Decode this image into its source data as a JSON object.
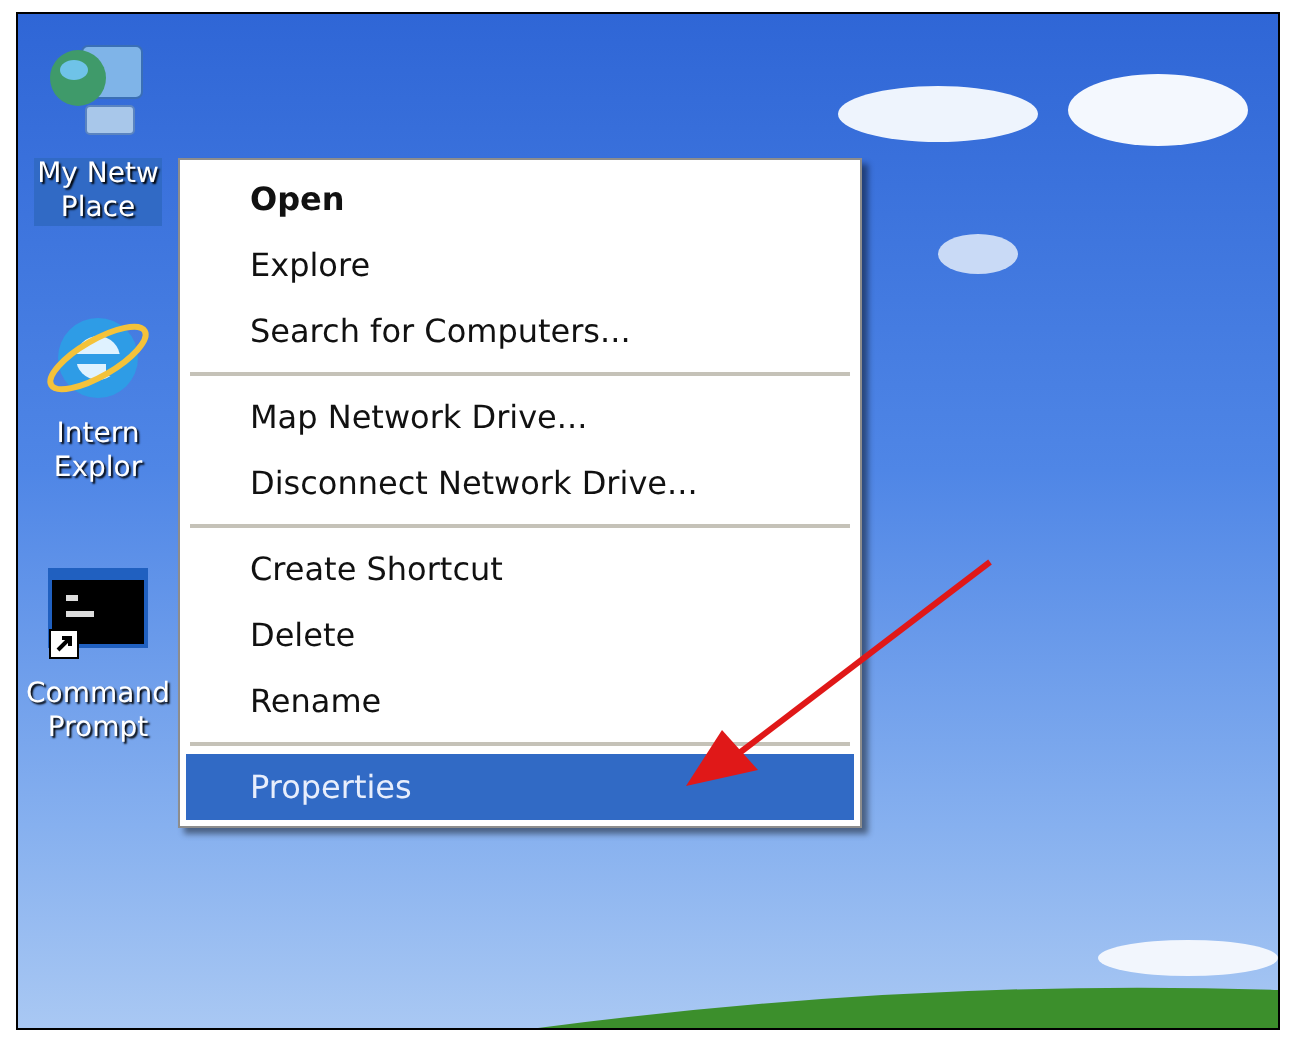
{
  "desktop_icons": [
    {
      "kind": "network",
      "label_lines": [
        "My Netw",
        "Place"
      ],
      "selected": true
    },
    {
      "kind": "browser",
      "label_lines": [
        "Intern",
        "Explor"
      ],
      "selected": false
    },
    {
      "kind": "console",
      "label_lines": [
        "Command",
        "Prompt"
      ],
      "selected": false
    }
  ],
  "context_menu": {
    "sections": [
      [
        {
          "label": "Open",
          "default": true,
          "selected": false
        },
        {
          "label": "Explore",
          "default": false,
          "selected": false
        },
        {
          "label": "Search for Computers...",
          "default": false,
          "selected": false
        }
      ],
      [
        {
          "label": "Map Network Drive...",
          "default": false,
          "selected": false
        },
        {
          "label": "Disconnect Network Drive...",
          "default": false,
          "selected": false
        }
      ],
      [
        {
          "label": "Create Shortcut",
          "default": false,
          "selected": false
        },
        {
          "label": "Delete",
          "default": false,
          "selected": false
        },
        {
          "label": "Rename",
          "default": false,
          "selected": false
        }
      ],
      [
        {
          "label": "Properties",
          "default": false,
          "selected": true
        }
      ]
    ]
  }
}
